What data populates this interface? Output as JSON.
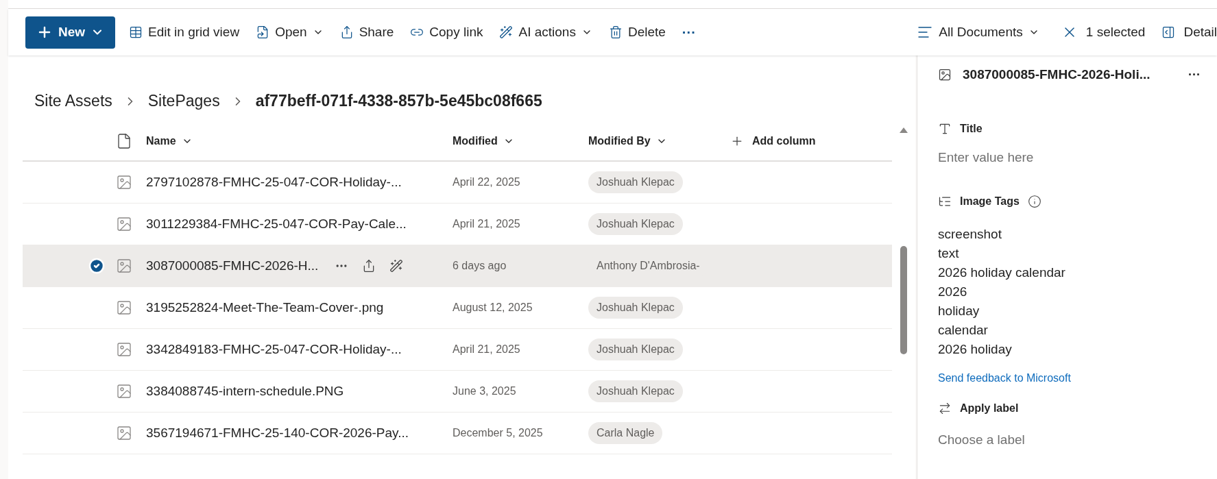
{
  "toolbar": {
    "new_label": "New",
    "items": [
      {
        "kind": "grid",
        "label": "Edit in grid view",
        "dropdown": false
      },
      {
        "kind": "open",
        "label": "Open",
        "dropdown": true
      },
      {
        "kind": "share",
        "label": "Share",
        "dropdown": false
      },
      {
        "kind": "link",
        "label": "Copy link",
        "dropdown": false
      },
      {
        "kind": "ai",
        "label": "AI actions",
        "dropdown": true
      },
      {
        "kind": "delete",
        "label": "Delete",
        "dropdown": false
      },
      {
        "kind": "more",
        "label": "···"
      }
    ],
    "view": "All Documents",
    "selection": "1 selected",
    "details": "Detail"
  },
  "breadcrumb": [
    {
      "label": "Site Assets",
      "selected": false
    },
    {
      "label": "SitePages",
      "selected": false
    },
    {
      "label": "af77beff-071f-4338-857b-5e45bc08f665",
      "selected": true
    }
  ],
  "table": {
    "columns": [
      "Name",
      "Modified",
      "Modified By"
    ],
    "add_column": "Add column",
    "rows": [
      {
        "name": "2797102878-FMHC-25-047-COR-Holiday-...",
        "modified": "April 22, 2025",
        "modified_by": "Joshuah Klepac",
        "selected": false
      },
      {
        "name": "3011229384-FMHC-25-047-COR-Pay-Cale...",
        "modified": "April 21, 2025",
        "modified_by": "Joshuah Klepac",
        "selected": false
      },
      {
        "name": "3087000085-FMHC-2026-H...",
        "modified": "6 days ago",
        "modified_by": "Anthony D'Ambrosia-",
        "selected": true
      },
      {
        "name": "3195252824-Meet-The-Team-Cover-.png",
        "modified": "August 12, 2025",
        "modified_by": "Joshuah Klepac",
        "selected": false
      },
      {
        "name": "3342849183-FMHC-25-047-COR-Holiday-...",
        "modified": "April 21, 2025",
        "modified_by": "Joshuah Klepac",
        "selected": false
      },
      {
        "name": "3384088745-intern-schedule.PNG",
        "modified": "June 3, 2025",
        "modified_by": "Joshuah Klepac",
        "selected": false
      },
      {
        "name": "3567194671-FMHC-25-140-COR-2026-Pay...",
        "modified": "December 5, 2025",
        "modified_by": "Carla Nagle",
        "selected": false
      }
    ]
  },
  "details_panel": {
    "file_name": "3087000085-FMHC-2026-Holi...",
    "more": "···",
    "title_label": "Title",
    "title_placeholder": "Enter value here",
    "tags_label": "Image Tags",
    "tags": [
      "screenshot",
      "text",
      "2026 holiday calendar",
      "2026",
      "holiday",
      "calendar",
      "2026 holiday"
    ],
    "feedback_link": "Send feedback to Microsoft",
    "label_heading": "Apply label",
    "label_placeholder": "Choose a label"
  }
}
